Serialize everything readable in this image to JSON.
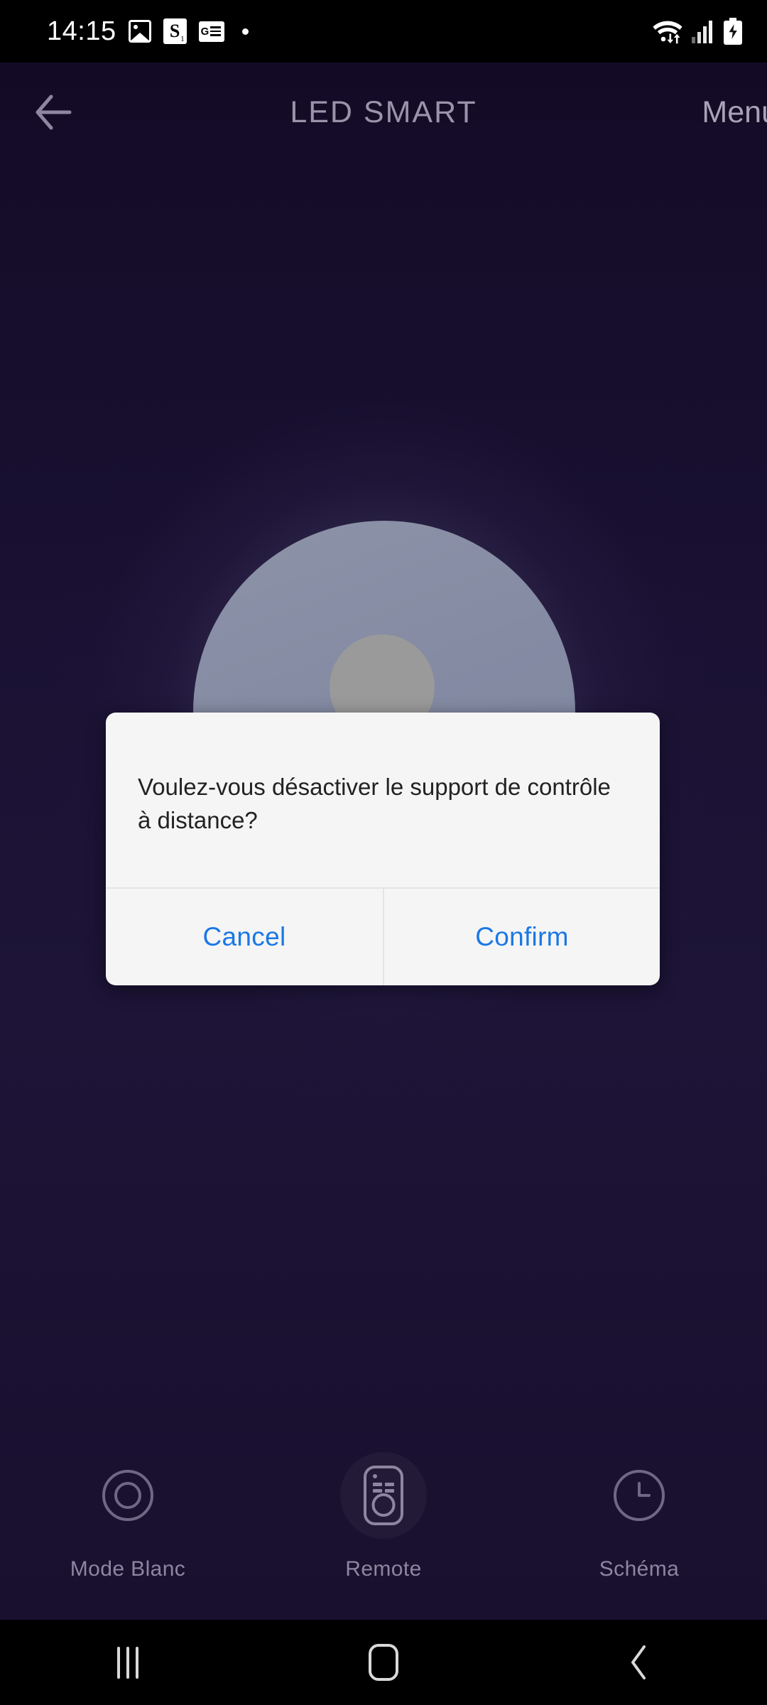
{
  "status_bar": {
    "time": "14:15",
    "left_icons": [
      {
        "name": "photos-icon",
        "glyph": "image"
      },
      {
        "name": "scrabble-icon",
        "glyph": "S",
        "sub": "1"
      },
      {
        "name": "google-news-icon",
        "glyph": "G"
      },
      {
        "name": "notification-dot-icon",
        "glyph": "dot"
      }
    ],
    "right_icons": [
      {
        "name": "wifi-icon",
        "label": "wifi-with-data-arrows"
      },
      {
        "name": "cellular-signal-icon",
        "label": "signal-3-bars"
      },
      {
        "name": "battery-charging-icon",
        "label": "battery-charging"
      }
    ]
  },
  "header": {
    "back_label": "back-arrow",
    "title": "LED SMART",
    "menu_label": "Menu"
  },
  "dialog": {
    "message": "Voulez-vous désactiver le support de contrôle à distance?",
    "cancel_label": "Cancel",
    "confirm_label": "Confirm",
    "accent_color": "#1a78e5",
    "background_color": "#f5f5f5"
  },
  "lamp": {
    "dial_color": "#858ba4",
    "knob_color": "#9a9a9a",
    "glow_color": "#b0b2cd"
  },
  "bottom_nav": {
    "items": [
      {
        "label": "Mode Blanc",
        "icon": "donut-icon",
        "active": false
      },
      {
        "label": "Remote",
        "icon": "remote-control-icon",
        "active": true
      },
      {
        "label": "Schéma",
        "icon": "clock-icon",
        "active": false
      }
    ]
  },
  "system_nav": {
    "recents_label": "recents-button",
    "home_label": "home-button",
    "back_label": "back-button"
  },
  "theme": {
    "app_background": "#1a1133",
    "text_muted": "#8d86a0",
    "title_color": "#9a94ab"
  }
}
